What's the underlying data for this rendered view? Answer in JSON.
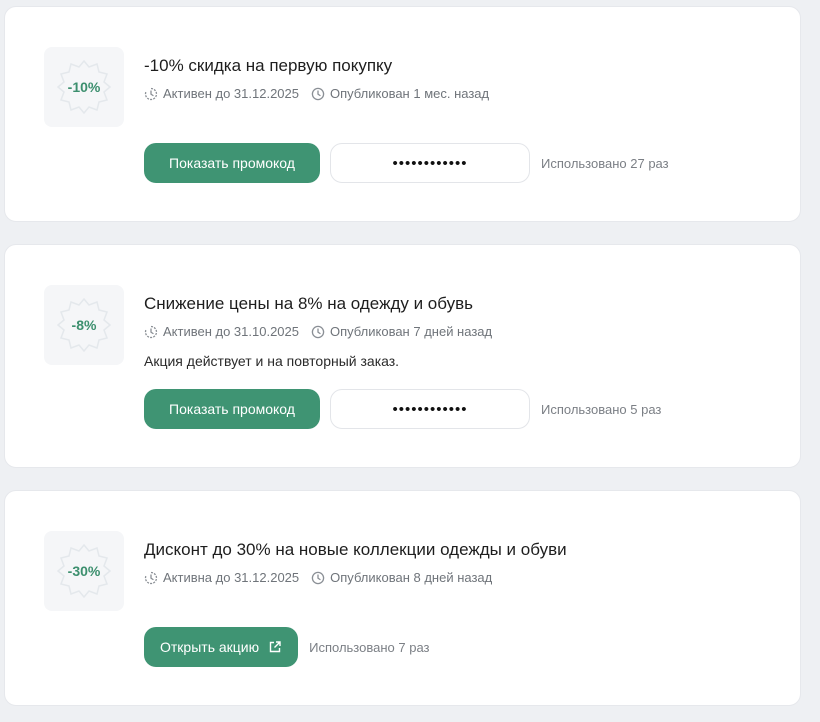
{
  "promos": [
    {
      "badge": "-10%",
      "title": "-10% скидка на первую покупку",
      "status": "Активен до 31.12.2025",
      "published": "Опубликован 1 мес. назад",
      "description": "",
      "button": "Показать промокод",
      "code": "••••••••••••",
      "used": "Использовано 27 раз"
    },
    {
      "badge": "-8%",
      "title": "Снижение цены на 8% на одежду и обувь",
      "status": "Активен до 31.10.2025",
      "published": "Опубликован 7 дней назад",
      "description": "Акция действует и на повторный заказ.",
      "button": "Показать промокод",
      "code": "••••••••••••",
      "used": "Использовано 5 раз"
    },
    {
      "badge": "-30%",
      "title": "Дисконт до 30% на новые коллекции одежды и обуви",
      "status": "Активна до 31.12.2025",
      "published": "Опубликован 8 дней назад",
      "description": "",
      "button": "Открыть акцию",
      "used": "Использовано 7 раз"
    }
  ],
  "colors": {
    "accent": "#3f9473",
    "badge_text": "#3c8f6e",
    "page_bg": "#eef0f3",
    "muted_text": "#6f747a"
  },
  "icons": {
    "status": "timer-icon",
    "published": "clock-icon",
    "external": "external-link-icon"
  }
}
